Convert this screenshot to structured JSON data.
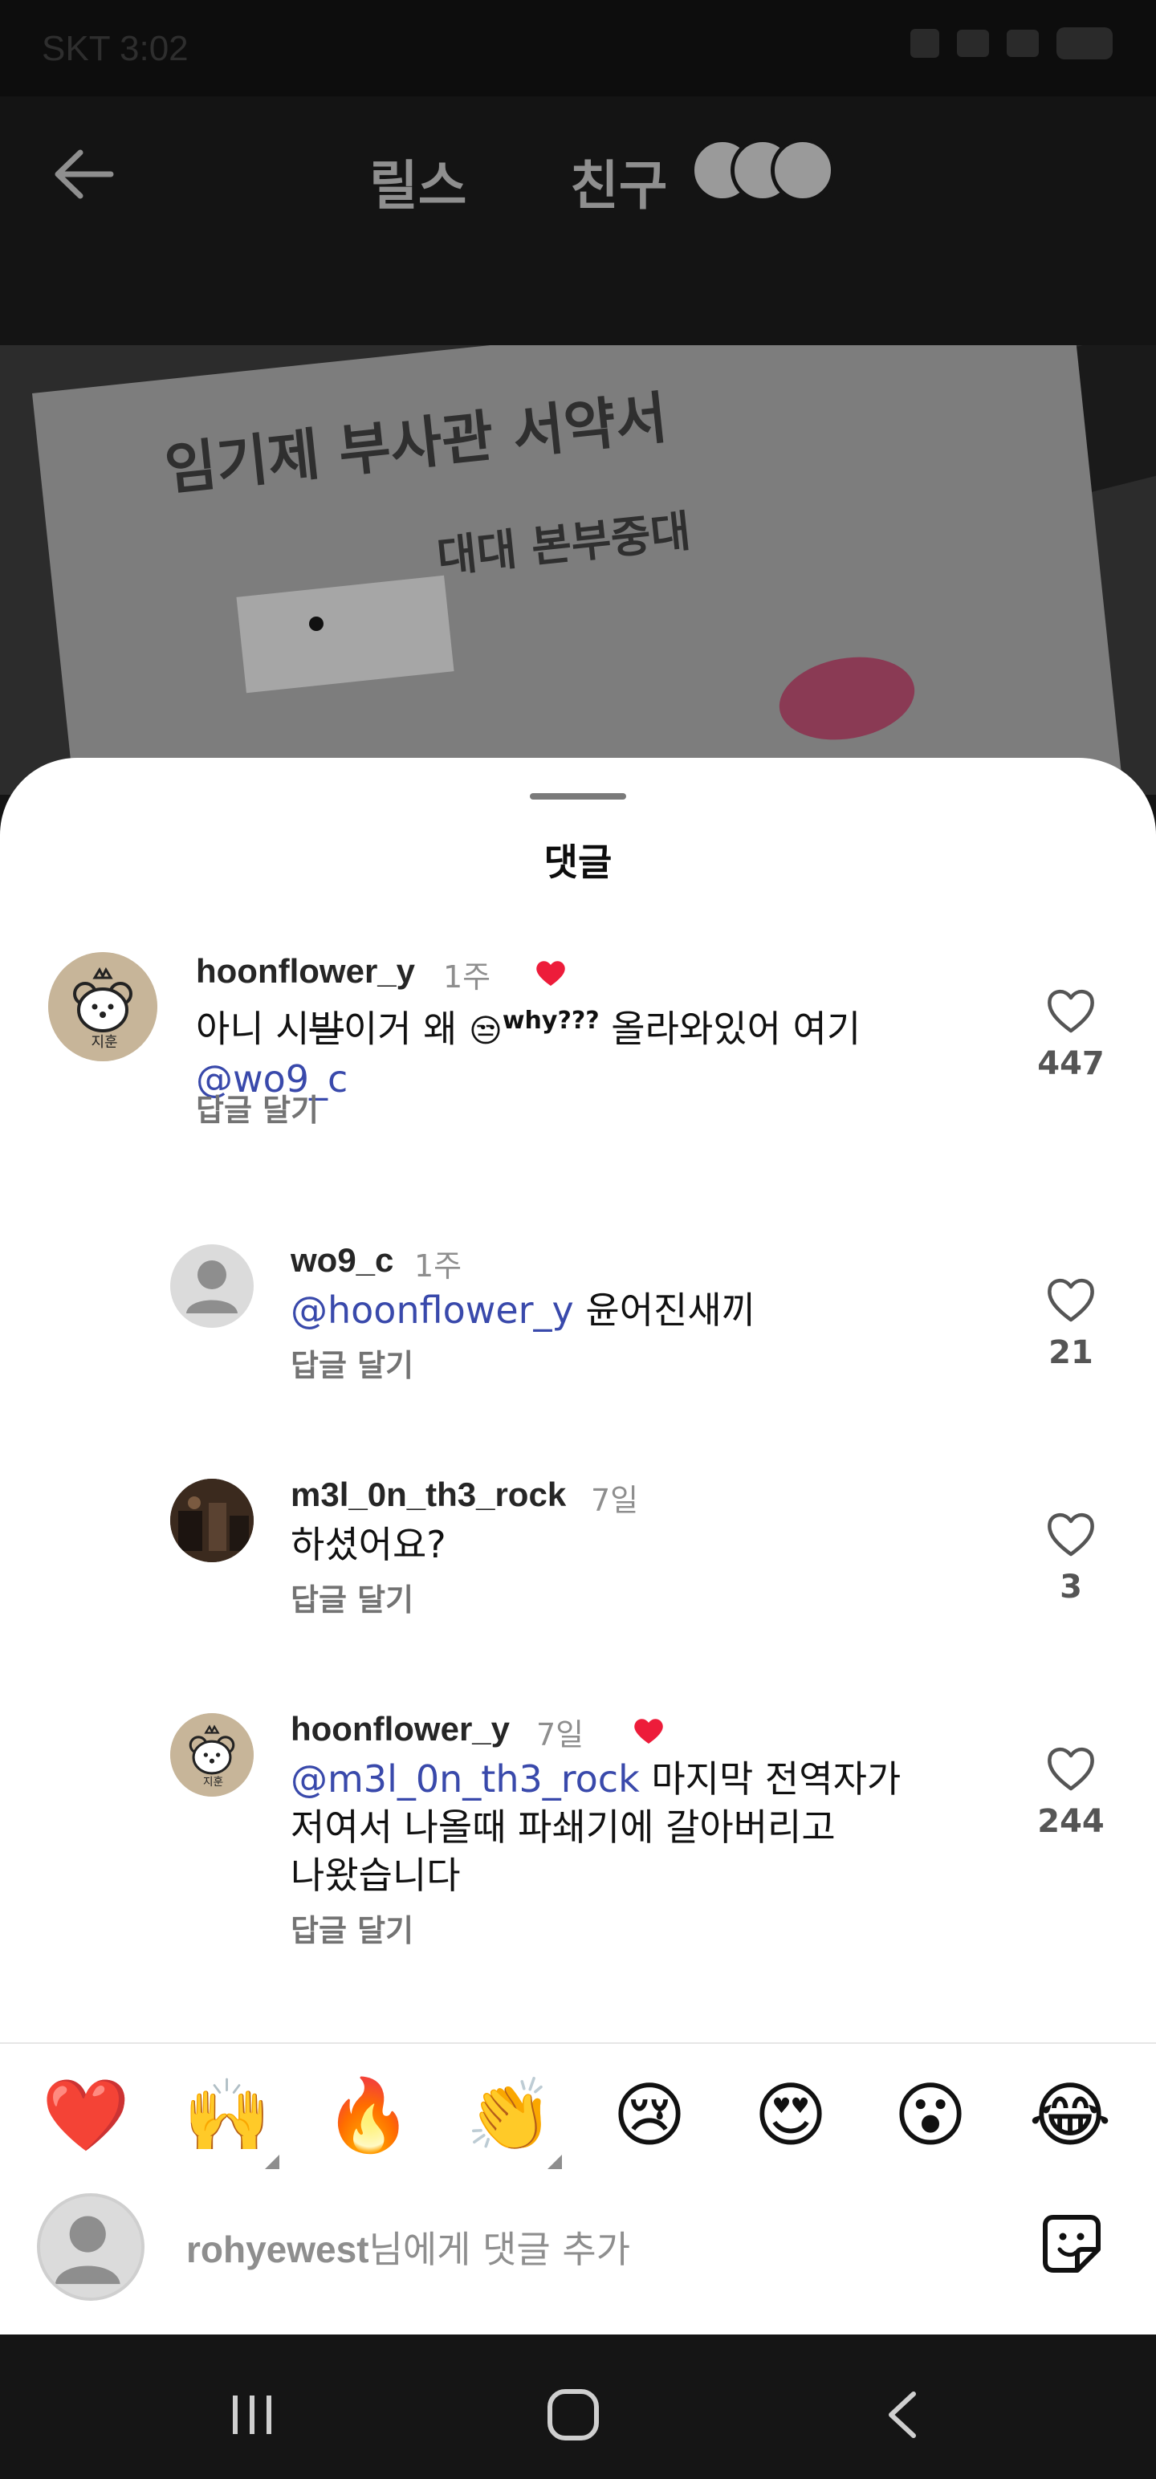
{
  "status_bar": {
    "time": "SKT 3:02"
  },
  "header": {
    "back_icon": "arrow-left-icon",
    "tabs": [
      {
        "label": "릴스"
      },
      {
        "label": "친구"
      }
    ]
  },
  "video": {
    "paper_title": "임기제 부사관 서약서",
    "paper_subtitle": "대대 본부중대"
  },
  "comments_sheet": {
    "title": "댓글",
    "comments": [
      {
        "username": "hoonflower_y",
        "time": "1주",
        "author_liked": true,
        "text_before": "아니 시",
        "text_scribble": "발",
        "text_after": "이거 왜 ",
        "text_emoji": "😒",
        "text_why": "why???",
        "text_end": " 올라와있어 여기",
        "mention": "wo9_c",
        "reply_label": "답글 달기",
        "likes": "447"
      },
      {
        "username": "wo9_c",
        "time": "1주",
        "mention": "hoonflower_y",
        "text": " 윤어진새끼",
        "reply_label": "답글 달기",
        "likes": "21"
      },
      {
        "username": "m3l_0n_th3_rock",
        "time": "7일",
        "text": "하셨어요?",
        "reply_label": "답글 달기",
        "likes": "3"
      },
      {
        "username": "hoonflower_y",
        "time": "7일",
        "author_liked": true,
        "mention": "m3l_0n_th3_rock",
        "text_line1": " 마지막 전역자가",
        "text_line2": "저여서 나올때 파쇄기에 갈아버리고",
        "text_line3": "나왔습니다",
        "reply_label": "답글 달기",
        "likes": "244"
      }
    ]
  },
  "emoji_bar": {
    "emojis": [
      "❤️",
      "🙌",
      "🔥",
      "👏",
      "😢",
      "😍",
      "😮",
      "😂"
    ]
  },
  "comment_input": {
    "target_username": "rohyewest",
    "placeholder_suffix": "님에게 댓글 추가"
  },
  "nav_bar": {
    "recent_icon": "recent-apps-icon",
    "home_icon": "home-icon",
    "back_icon": "back-icon"
  }
}
